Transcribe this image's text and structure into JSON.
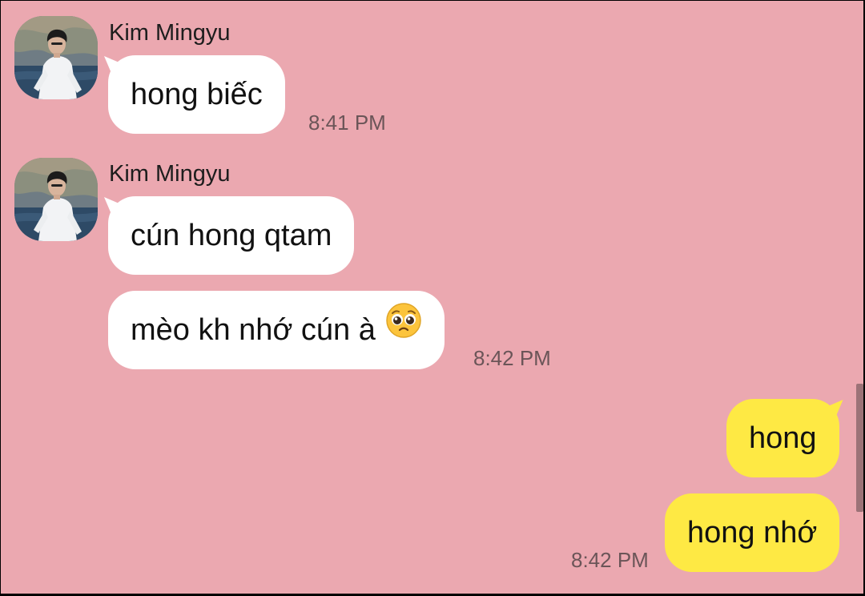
{
  "messages": [
    {
      "sender": "Kim Mingyu",
      "text": "hong biếc",
      "time": "8:41 PM"
    },
    {
      "sender": "Kim Mingyu",
      "text": "cún hong qtam"
    },
    {
      "text": "mèo kh nhớ cún à",
      "emoji": "pleading-face-emoji",
      "time": "8:42 PM"
    },
    {
      "text": "hong"
    },
    {
      "text": "hong nhớ",
      "time": "8:42 PM"
    }
  ],
  "colors": {
    "background": "#eba8b0",
    "incoming_bubble": "#ffffff",
    "outgoing_bubble": "#fee944",
    "timestamp": "#6b5558"
  }
}
